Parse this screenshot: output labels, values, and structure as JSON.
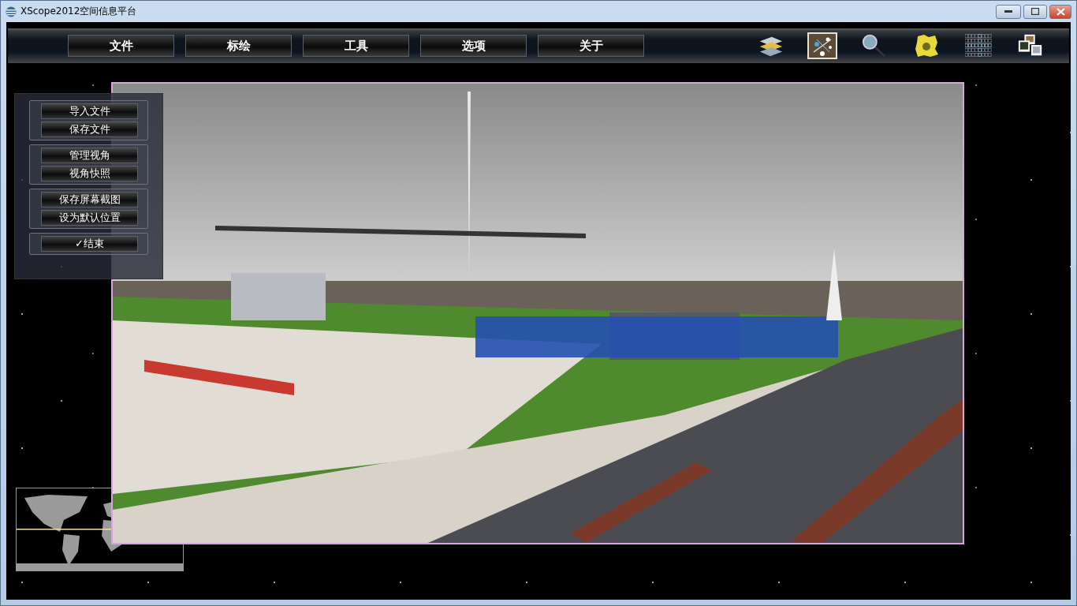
{
  "window": {
    "title": "XScope2012空间信息平台"
  },
  "menu": [
    {
      "label": "文件"
    },
    {
      "label": "标绘"
    },
    {
      "label": "工具"
    },
    {
      "label": "选项"
    },
    {
      "label": "关于"
    }
  ],
  "toolbar": [
    {
      "kind": "layers",
      "selected": false
    },
    {
      "kind": "network",
      "selected": true
    },
    {
      "kind": "search",
      "selected": false
    },
    {
      "kind": "cluster",
      "selected": false
    },
    {
      "kind": "grid",
      "selected": false
    },
    {
      "kind": "photos",
      "selected": false
    }
  ],
  "side_panel": {
    "groups": [
      {
        "buttons": [
          "导入文件",
          "保存文件"
        ]
      },
      {
        "buttons": [
          "管理视角",
          "视角快照"
        ]
      },
      {
        "buttons": [
          "保存屏幕截图",
          "设为默认位置"
        ]
      },
      {
        "buttons": [
          "✓结束"
        ]
      }
    ]
  },
  "minimap": {
    "kind": "world_map"
  }
}
